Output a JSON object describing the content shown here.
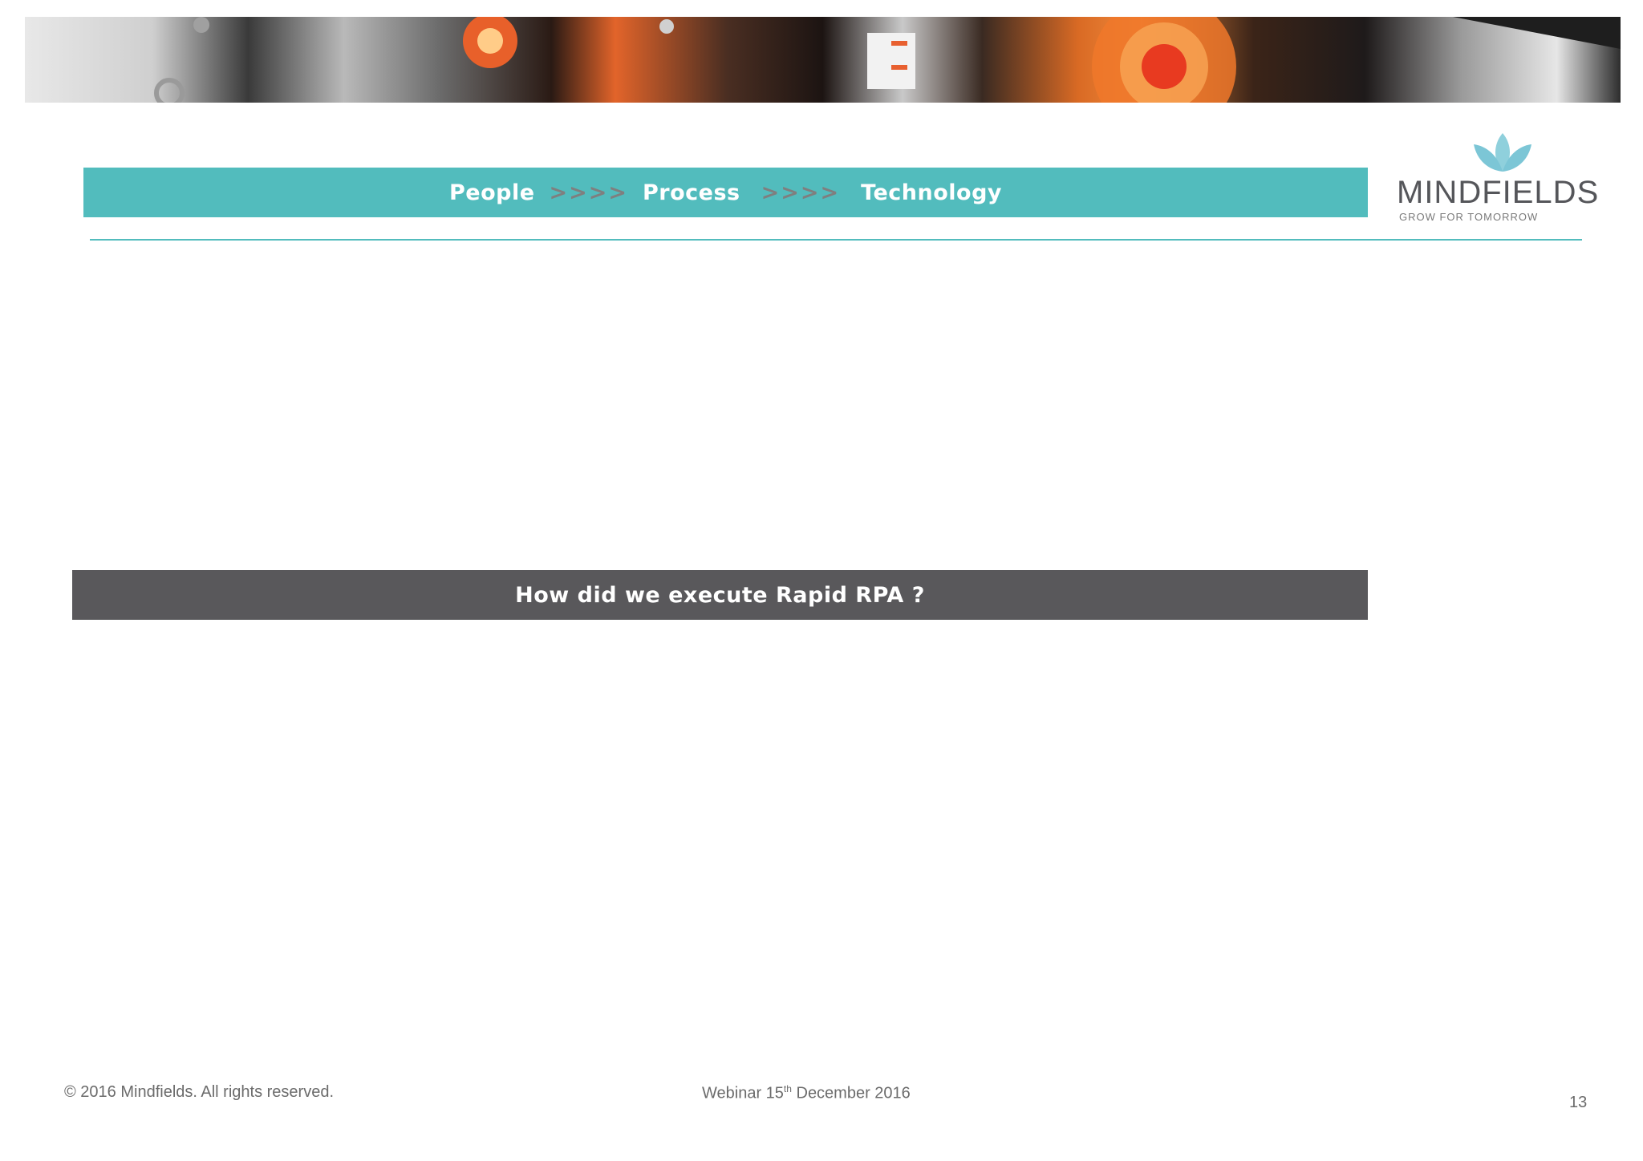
{
  "header": {
    "people": "People",
    "arrows_1": ">>>>",
    "process": "Process",
    "arrows_2": ">>>>",
    "technology": "Technology"
  },
  "logo": {
    "name": "MINDFIELDS",
    "tagline": "GROW FOR TOMORROW"
  },
  "section": {
    "title": "How did we execute Rapid RPA ?"
  },
  "footer": {
    "copyright": "© 2016  Mindfields. All rights reserved.",
    "webinar_prefix": "Webinar 15",
    "webinar_sup": "th",
    "webinar_suffix": " December 2016",
    "page_number": "13"
  },
  "colors": {
    "teal": "#52bcbd",
    "dark_gray": "#59585b",
    "text_gray": "#6b6b6b"
  }
}
